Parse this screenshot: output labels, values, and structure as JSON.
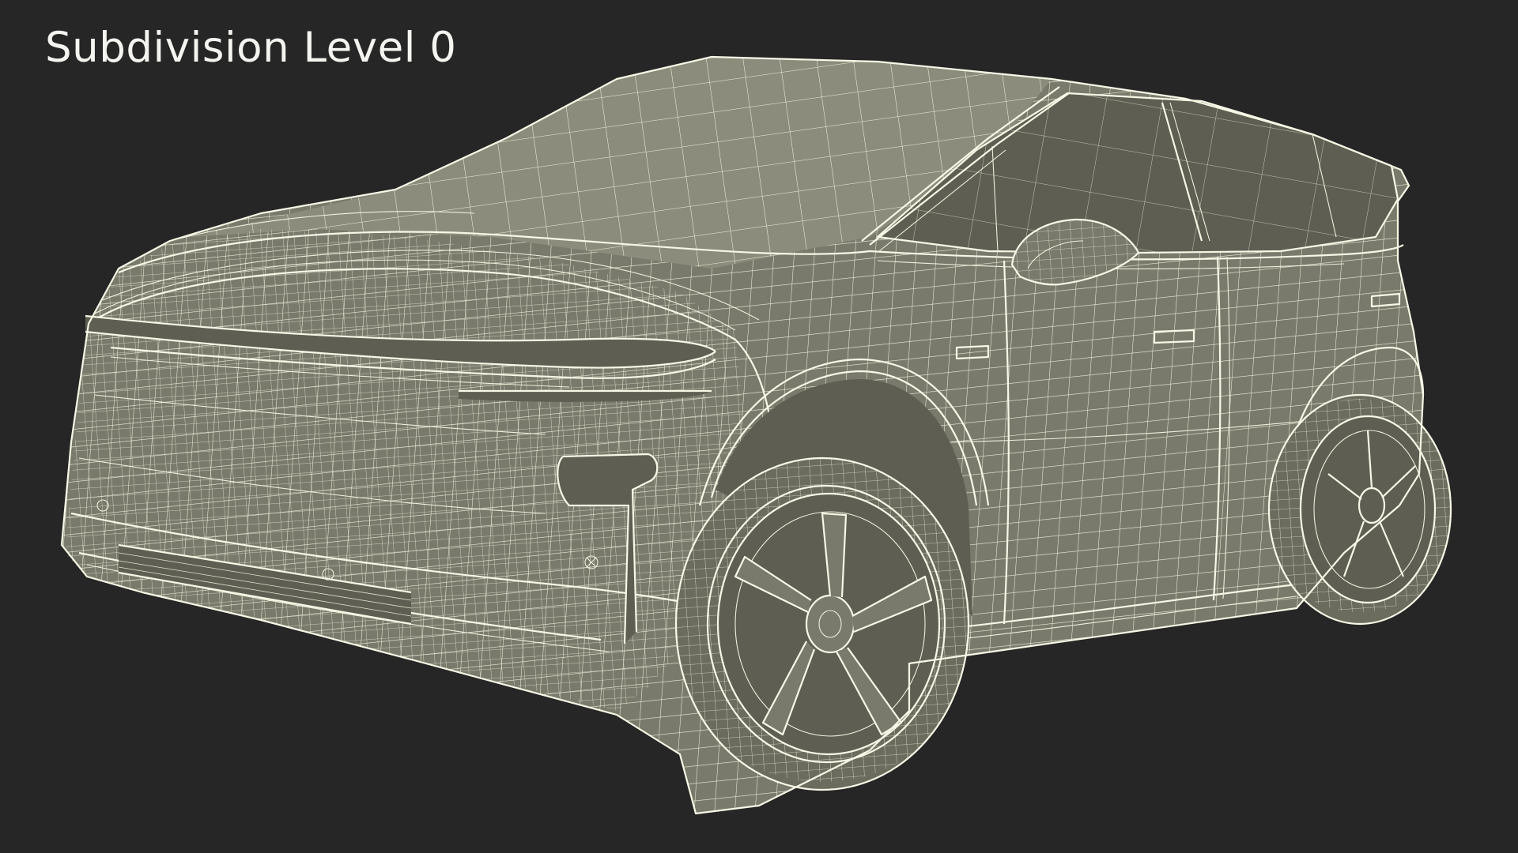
{
  "caption": "Subdivision Level 0",
  "colors": {
    "background": "#262626",
    "model_surface": "#7a7a6c",
    "wireframe": "#efefdc",
    "caption_text": "#f4f4f0"
  },
  "subject": "car-wireframe-render"
}
